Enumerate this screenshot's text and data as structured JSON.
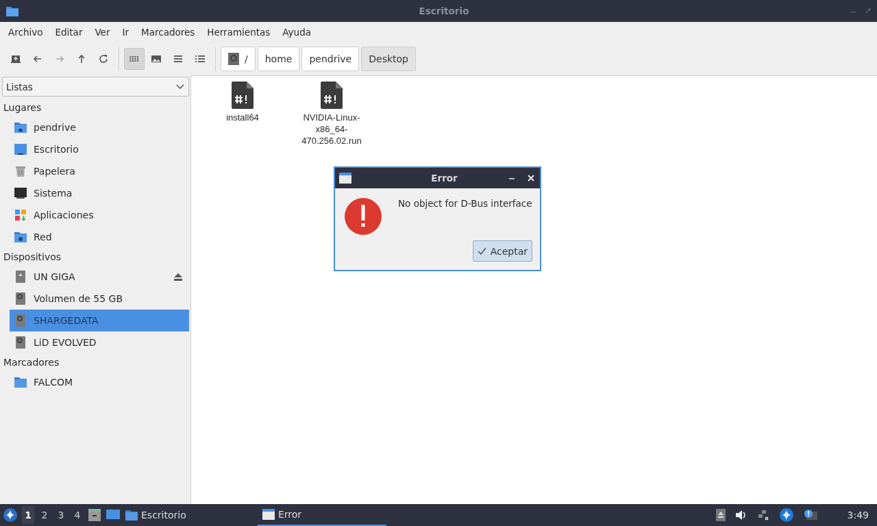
{
  "window": {
    "title": "Escritorio"
  },
  "menu": [
    "Archivo",
    "Editar",
    "Ver",
    "Ir",
    "Marcadores",
    "Herramientas",
    "Ayuda"
  ],
  "toolbar": {
    "nav": [
      {
        "kind": "new-tab",
        "disabled": false
      },
      {
        "kind": "back",
        "disabled": false
      },
      {
        "kind": "forward",
        "disabled": true
      },
      {
        "kind": "up",
        "disabled": false
      },
      {
        "kind": "reload",
        "disabled": false
      }
    ],
    "view_modes": [
      {
        "kind": "icons",
        "selected": true
      },
      {
        "kind": "thumbnails",
        "selected": false
      },
      {
        "kind": "compact",
        "selected": false
      },
      {
        "kind": "details",
        "selected": false
      }
    ],
    "path": [
      {
        "label": "/",
        "kind": "root",
        "selected": false
      },
      {
        "label": "home",
        "kind": "dir",
        "selected": false
      },
      {
        "label": "pendrive",
        "kind": "dir",
        "selected": false
      },
      {
        "label": "Desktop",
        "kind": "dir",
        "selected": true
      }
    ]
  },
  "sidebar": {
    "dropdown": "Listas",
    "sections": [
      {
        "title": "Lugares",
        "items": [
          {
            "label": "pendrive",
            "kind": "home",
            "selected": false,
            "ejectable": false
          },
          {
            "label": "Escritorio",
            "kind": "desktop",
            "selected": false,
            "ejectable": false
          },
          {
            "label": "Papelera",
            "kind": "trash",
            "selected": false,
            "ejectable": false
          },
          {
            "label": "Sistema",
            "kind": "system",
            "selected": false,
            "ejectable": false
          },
          {
            "label": "Aplicaciones",
            "kind": "apps",
            "selected": false,
            "ejectable": false
          },
          {
            "label": "Red",
            "kind": "network",
            "selected": false,
            "ejectable": false
          }
        ]
      },
      {
        "title": "Dispositivos",
        "items": [
          {
            "label": "UN GIGA",
            "kind": "removable",
            "selected": false,
            "ejectable": true
          },
          {
            "label": "Volumen de 55 GB",
            "kind": "drive",
            "selected": false,
            "ejectable": false
          },
          {
            "label": "SHARGEDATA",
            "kind": "drive",
            "selected": true,
            "ejectable": false
          },
          {
            "label": "LiD EVOLVED",
            "kind": "drive",
            "selected": false,
            "ejectable": false
          }
        ]
      },
      {
        "title": "Marcadores",
        "items": [
          {
            "label": "FALCOM",
            "kind": "folder",
            "selected": false,
            "ejectable": false
          }
        ]
      }
    ]
  },
  "files": [
    {
      "name": "install64"
    },
    {
      "name": "NVIDIA-Linux-x86_64-470.256.02.run"
    }
  ],
  "dialog": {
    "title": "Error",
    "message": "No object for D-Bus interface",
    "button": "Aceptar"
  },
  "taskbar": {
    "workspaces": [
      {
        "label": "1",
        "selected": true
      },
      {
        "label": "2",
        "selected": false
      },
      {
        "label": "3",
        "selected": false
      },
      {
        "label": "4",
        "selected": false
      }
    ],
    "tasks": [
      {
        "label": "Escritorio",
        "kind": "folder",
        "selected": false
      },
      {
        "label": "Error",
        "kind": "window",
        "selected": true
      }
    ],
    "clock": "3:49"
  }
}
